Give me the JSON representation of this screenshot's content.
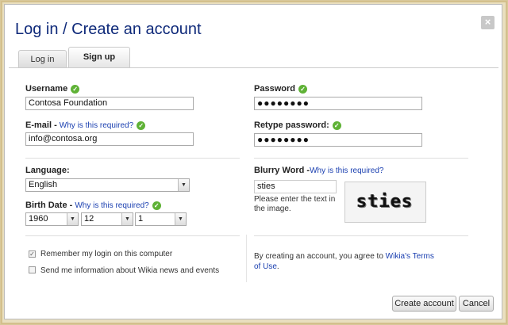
{
  "dialog": {
    "title": "Log in / Create an account",
    "close_glyph": "×"
  },
  "tabs": [
    {
      "label": "Log in"
    },
    {
      "label": "Sign up"
    }
  ],
  "form": {
    "username": {
      "label": "Username",
      "value": "Contosa Foundation"
    },
    "password": {
      "label": "Password",
      "value": "●●●●●●●●"
    },
    "email": {
      "label": "E-mail",
      "dash": " - ",
      "help": "Why is this required?",
      "value": "info@contosa.org"
    },
    "retype_password": {
      "label": "Retype password:",
      "value": "●●●●●●●●"
    },
    "language": {
      "label": "Language:",
      "value": "English"
    },
    "blurry_word": {
      "label": "Blurry Word",
      "dash": " -",
      "help": "Why is this required?",
      "value": "sties",
      "instruction": "Please enter the text in the image.",
      "captcha_text": "sties"
    },
    "birth_date": {
      "label": "Birth Date",
      "dash": " - ",
      "help": "Why is this required?",
      "year": "1960",
      "month": "12",
      "day": "1"
    },
    "remember": {
      "label": "Remember my login on this computer",
      "checked": true
    },
    "newsletter": {
      "label": "Send me information about Wikia news and events",
      "checked": false
    },
    "terms": {
      "prefix": "By creating an account, you agree to ",
      "link": "Wikia's Terms of Use",
      "suffix": "."
    }
  },
  "buttons": {
    "create": "Create account",
    "cancel": "Cancel"
  },
  "icons": {
    "check": "✓",
    "dropdown": "▼",
    "checkbox_checked": "✓"
  },
  "colors": {
    "title": "#0f2a7a",
    "link": "#1a3fb0",
    "check": "#5fb236",
    "frame": "#d8c89a"
  }
}
